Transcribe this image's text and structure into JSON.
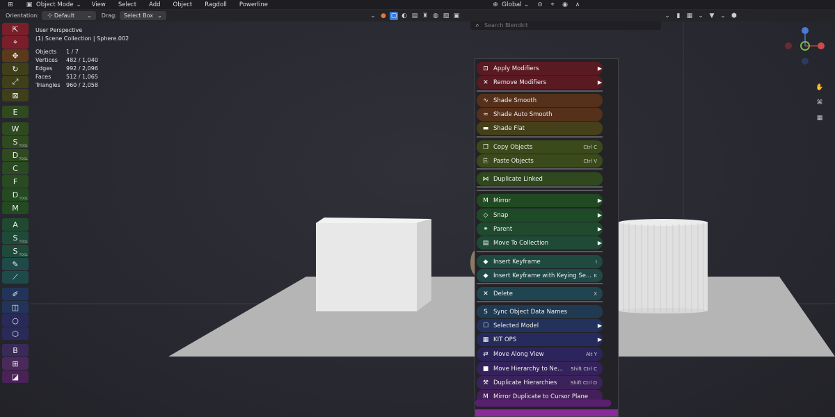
{
  "menubar": {
    "mode": "Object Mode",
    "items": [
      "View",
      "Select",
      "Add",
      "Object",
      "Ragdoll",
      "Powerline"
    ],
    "transform_orientation": "Global"
  },
  "header": {
    "orientation_label": "Orientation:",
    "orientation_value": "Default",
    "drag_label": "Drag:",
    "drag_value": "Select Box",
    "search_placeholder": "Search Blendkit"
  },
  "toolbar": {
    "buttons": [
      {
        "label": "",
        "icon": "select-cursor-icon",
        "color": "#7a1f2a"
      },
      {
        "label": "",
        "icon": "cursor-icon",
        "color": "#7a1f2a"
      },
      {
        "label": "",
        "icon": "move-icon",
        "color": "#5a3a1a"
      },
      {
        "label": "",
        "icon": "rotate-icon",
        "color": "#3f3f1a"
      },
      {
        "label": "",
        "icon": "scale-icon",
        "color": "#3f3f1a"
      },
      {
        "label": "",
        "icon": "transform-icon",
        "color": "#3f3f1a"
      },
      {
        "label": "E",
        "sub": "",
        "color": "#2f4a1f"
      },
      {
        "label": "W",
        "sub": "",
        "color": "#2f4a1f"
      },
      {
        "label": "S",
        "sub": "TOOL",
        "color": "#2f4a1f"
      },
      {
        "label": "D",
        "sub": "TOOL",
        "color": "#2f4a1f"
      },
      {
        "label": "C",
        "sub": "",
        "color": "#2a4a22"
      },
      {
        "label": "F",
        "sub": "",
        "color": "#2a4a22"
      },
      {
        "label": "D",
        "sub": "TOOL",
        "color": "#244a22"
      },
      {
        "label": "M",
        "sub": "",
        "color": "#244a22"
      },
      {
        "label": "A",
        "sub": "",
        "color": "#1f4a2f"
      },
      {
        "label": "S",
        "sub": "TOOL",
        "color": "#1f4a3a"
      },
      {
        "label": "S",
        "sub": "TOOL",
        "color": "#1f4a3a"
      },
      {
        "label": "",
        "icon": "pencil-icon",
        "color": "#1f4a4a"
      },
      {
        "label": "",
        "icon": "ruler-icon",
        "color": "#1f4a4a"
      },
      {
        "label": "",
        "icon": "brush-icon",
        "color": "#22345a"
      },
      {
        "label": "",
        "icon": "box-icon",
        "color": "#22345a"
      },
      {
        "label": "",
        "icon": "circle-icon",
        "color": "#2a2a5a"
      },
      {
        "label": "",
        "icon": "shield-icon",
        "color": "#2a2a5a"
      },
      {
        "label": "B",
        "sub": "",
        "color": "#3a2a5a"
      },
      {
        "label": "",
        "icon": "grid-icon",
        "color": "#4a2a5a"
      },
      {
        "label": "",
        "icon": "square-icon",
        "color": "#4a2258"
      }
    ]
  },
  "overlay": {
    "view_name": "User Perspective",
    "collection": "(1) Scene Collection | Sphere.002",
    "stats": [
      {
        "label": "Objects",
        "value": "1 / 7"
      },
      {
        "label": "Vertices",
        "value": "482 / 1,040"
      },
      {
        "label": "Edges",
        "value": "992 / 2,096"
      },
      {
        "label": "Faces",
        "value": "512 / 1,065"
      },
      {
        "label": "Triangles",
        "value": "960 / 2,058"
      }
    ]
  },
  "context_menu": {
    "items": [
      {
        "label": "Apply Modifiers",
        "icon": "modifier-icon",
        "shortcut": "",
        "submenu": true,
        "color": "#5a1a22"
      },
      {
        "label": "Remove Modifiers",
        "icon": "close-icon",
        "shortcut": "",
        "submenu": true,
        "color": "#5a1a22"
      },
      {
        "label": "Shade Smooth",
        "icon": "wave-icon",
        "shortcut": "",
        "submenu": false,
        "color": "#55301a"
      },
      {
        "label": "Shade Auto Smooth",
        "icon": "approx-icon",
        "shortcut": "",
        "submenu": false,
        "color": "#55301a"
      },
      {
        "label": "Shade Flat",
        "icon": "dash-icon",
        "shortcut": "",
        "submenu": false,
        "color": "#45401a"
      },
      {
        "label": "Copy Objects",
        "icon": "copy-icon",
        "shortcut": "Ctrl C",
        "submenu": false,
        "color": "#3a4a1a"
      },
      {
        "label": "Paste Objects",
        "icon": "paste-icon",
        "shortcut": "Ctrl V",
        "submenu": false,
        "color": "#3a4a1a"
      },
      {
        "label": "Duplicate Linked",
        "icon": "link-icon",
        "shortcut": "",
        "submenu": false,
        "color": "#2f481e"
      },
      {
        "label": "Mirror",
        "icon": "mirror-icon",
        "shortcut": "",
        "submenu": true,
        "color": "#214a22"
      },
      {
        "label": "Snap",
        "icon": "snap-icon",
        "shortcut": "",
        "submenu": true,
        "color": "#1f4a26"
      },
      {
        "label": "Parent",
        "icon": "parent-icon",
        "shortcut": "",
        "submenu": true,
        "color": "#1f4a2e"
      },
      {
        "label": "Move To Collection",
        "icon": "collection-icon",
        "shortcut": "",
        "submenu": true,
        "color": "#1f4a36"
      },
      {
        "label": "Insert Keyframe",
        "icon": "keyframe-icon",
        "shortcut": "I",
        "submenu": false,
        "color": "#1f4a40"
      },
      {
        "label": "Insert Keyframe with Keying Se...",
        "icon": "keyframe-icon",
        "shortcut": "K",
        "submenu": false,
        "color": "#1f4a48"
      },
      {
        "label": "Delete",
        "icon": "close-icon",
        "shortcut": "X",
        "submenu": false,
        "color": "#1f4550"
      },
      {
        "label": "Sync Object Data Names",
        "icon": "s-icon",
        "shortcut": "",
        "submenu": false,
        "color": "#1f3a52"
      },
      {
        "label": "Selected Model",
        "icon": "square-icon",
        "shortcut": "",
        "submenu": true,
        "color": "#22325a"
      },
      {
        "label": "KIT OPS",
        "icon": "grid-icon",
        "shortcut": "",
        "submenu": true,
        "color": "#262a5c"
      },
      {
        "label": "Move Along View",
        "icon": "move-view-icon",
        "shortcut": "Alt Y",
        "submenu": false,
        "color": "#2c245c"
      },
      {
        "label": "Move Hierarchy to Ne...",
        "icon": "hierarchy-icon",
        "shortcut": "Shift Ctrl C",
        "submenu": false,
        "color": "#34225c"
      },
      {
        "label": "Duplicate Hierarchies",
        "icon": "wrench-icon",
        "shortcut": "Shift Ctrl D",
        "submenu": false,
        "color": "#3c225a"
      },
      {
        "label": "Mirror Duplicate to Cursor Plane",
        "icon": "mirror-icon",
        "shortcut": "",
        "submenu": false,
        "color": "#44205a"
      }
    ],
    "footer_color": "#8a2a9a"
  },
  "gizmo": {
    "z": "Z",
    "y": "Y",
    "x": "X"
  }
}
